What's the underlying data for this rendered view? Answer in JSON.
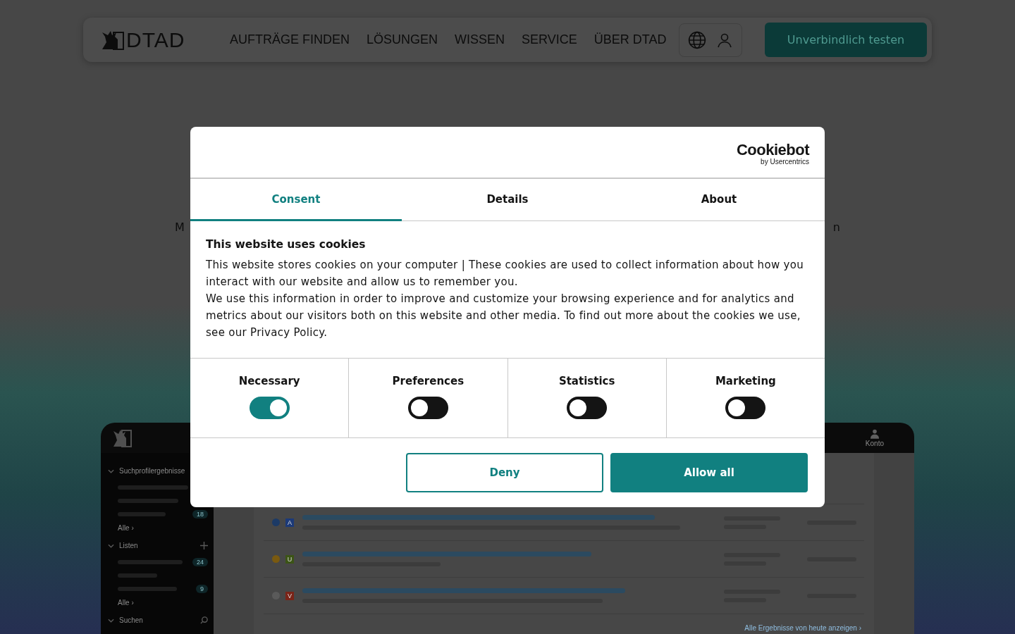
{
  "nav": {
    "logo": "DTAD",
    "items": [
      "AUFTRÄGE FINDEN",
      "LÖSUNGEN",
      "WISSEN",
      "SERVICE",
      "ÜBER DTAD"
    ],
    "cta": "Unverbindlich testen"
  },
  "hero": {
    "lead": {
      "left": "M",
      "right": "n"
    }
  },
  "dashboard": {
    "sections": [
      {
        "title": "Suchprofilergebnisse",
        "kind": "plain",
        "counts": [
          "18"
        ],
        "more": "Alle ›"
      },
      {
        "title": "Listen",
        "kind": "add",
        "counts": [
          "24",
          "9"
        ],
        "more": "Alle ›"
      },
      {
        "title": "Suchen",
        "kind": "search"
      }
    ],
    "account": "Konto",
    "rows": [
      {
        "badge": "A",
        "color": "#1c3a78",
        "marker": {
          "color": "#1c3a66"
        }
      },
      {
        "badge": "U",
        "color": "#3c5416",
        "marker": {
          "color": "#7a5a10"
        }
      },
      {
        "badge": "V",
        "color": "#7a2418",
        "marker": {
          "color": "#5a5a5a"
        }
      }
    ],
    "footer_link": "Alle Ergebnisse von heute anzeigen ›"
  },
  "cookie_dialog": {
    "brand": "Cookiebot",
    "brand_sub": "by Usercentrics",
    "tabs": [
      {
        "label": "Consent",
        "selected": true
      },
      {
        "label": "Details",
        "selected": false
      },
      {
        "label": "About",
        "selected": false
      }
    ],
    "heading": "This website uses cookies",
    "paragraphs": [
      "This website stores cookies on your computer | These cookies are used to collect information about how you interact with our website and allow us to remember you.",
      "We use this information in order to improve and customize your browsing experience and for analytics and metrics about our visitors both on this website and other media. To find out more about the cookies we use, see our Privacy Policy."
    ],
    "toggles": [
      {
        "label": "Necessary",
        "on": true
      },
      {
        "label": "Preferences",
        "on": false
      },
      {
        "label": "Statistics",
        "on": false
      },
      {
        "label": "Marketing",
        "on": false
      }
    ],
    "buttons": [
      {
        "label": "Deny",
        "kind": "outline"
      },
      {
        "label": "Allow all",
        "kind": "filled"
      }
    ]
  }
}
